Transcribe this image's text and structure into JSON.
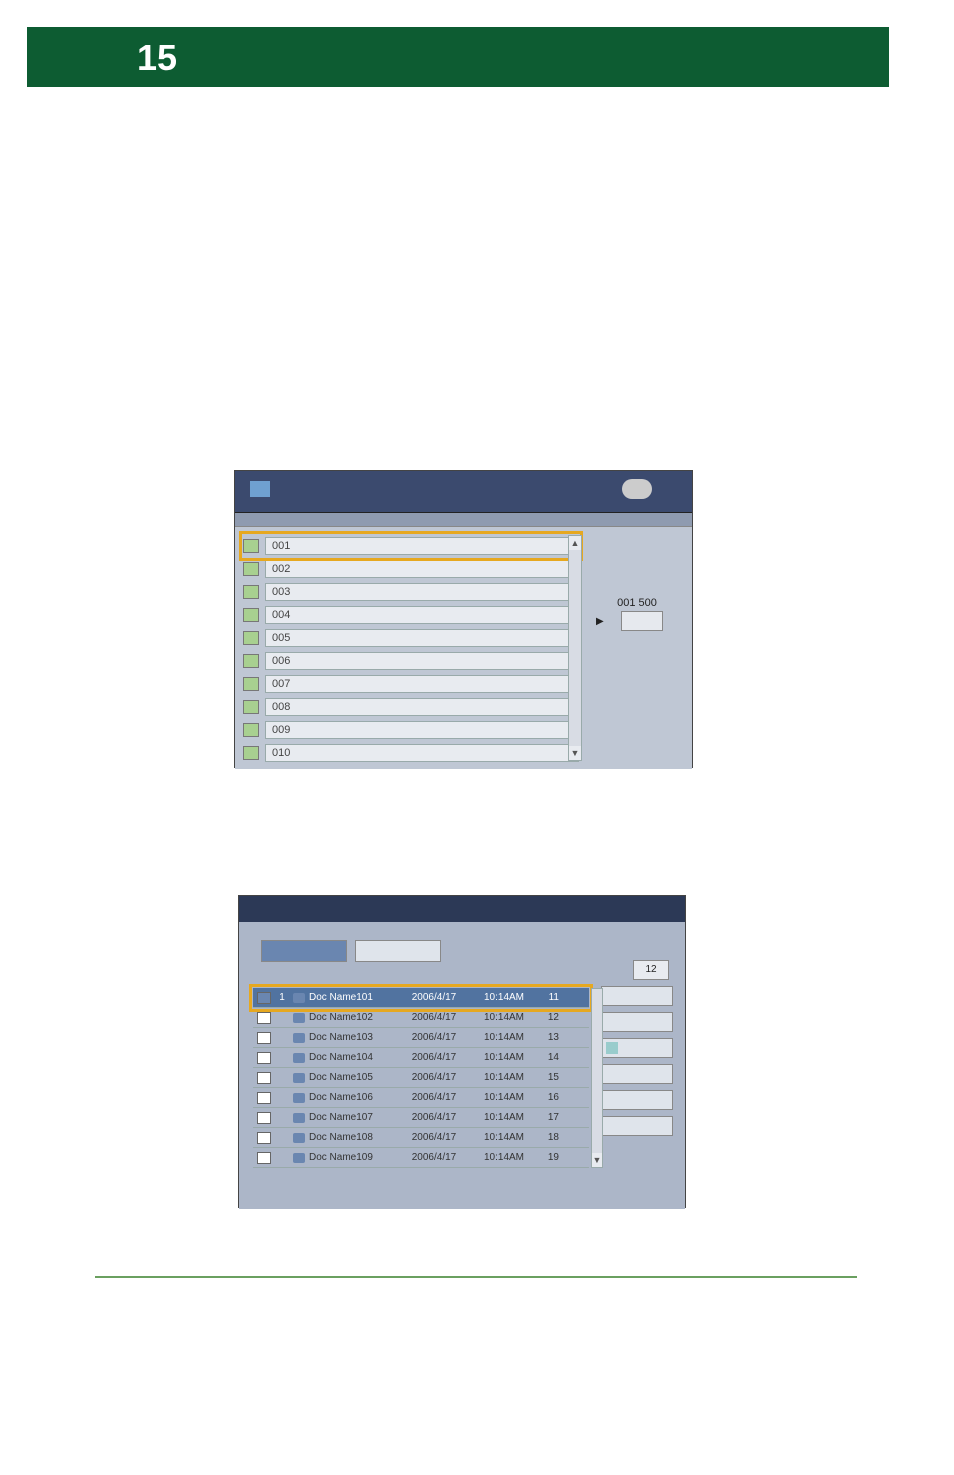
{
  "page_number": "15",
  "panel1": {
    "counter": "001   500",
    "rows": [
      {
        "id": "001"
      },
      {
        "id": "002"
      },
      {
        "id": "003"
      },
      {
        "id": "004"
      },
      {
        "id": "005"
      },
      {
        "id": "006"
      },
      {
        "id": "007"
      },
      {
        "id": "008"
      },
      {
        "id": "009"
      },
      {
        "id": "010"
      }
    ]
  },
  "panel2": {
    "badge": "12",
    "rows": [
      {
        "order": "1",
        "name": "Doc Name101",
        "date": "2006/4/17",
        "time": "10:14AM",
        "num": "11",
        "selected": true
      },
      {
        "order": "",
        "name": "Doc Name102",
        "date": "2006/4/17",
        "time": "10:14AM",
        "num": "12",
        "selected": false
      },
      {
        "order": "",
        "name": "Doc Name103",
        "date": "2006/4/17",
        "time": "10:14AM",
        "num": "13",
        "selected": false
      },
      {
        "order": "",
        "name": "Doc Name104",
        "date": "2006/4/17",
        "time": "10:14AM",
        "num": "14",
        "selected": false
      },
      {
        "order": "",
        "name": "Doc Name105",
        "date": "2006/4/17",
        "time": "10:14AM",
        "num": "15",
        "selected": false
      },
      {
        "order": "",
        "name": "Doc Name106",
        "date": "2006/4/17",
        "time": "10:14AM",
        "num": "16",
        "selected": false
      },
      {
        "order": "",
        "name": "Doc Name107",
        "date": "2006/4/17",
        "time": "10:14AM",
        "num": "17",
        "selected": false
      },
      {
        "order": "",
        "name": "Doc Name108",
        "date": "2006/4/17",
        "time": "10:14AM",
        "num": "18",
        "selected": false
      },
      {
        "order": "",
        "name": "Doc Name109",
        "date": "2006/4/17",
        "time": "10:14AM",
        "num": "19",
        "selected": false
      }
    ]
  }
}
